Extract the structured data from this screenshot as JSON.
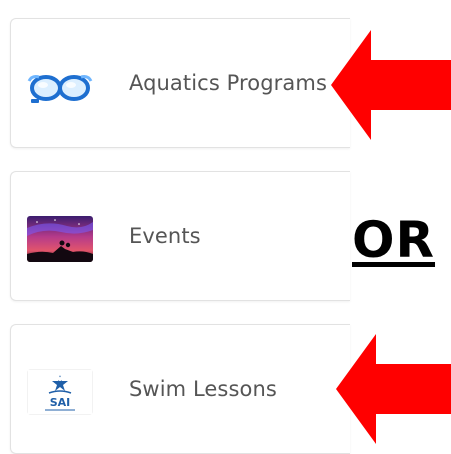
{
  "cards": [
    {
      "label": "Aquatics Programs",
      "icon": "swim-goggles-icon"
    },
    {
      "label": "Events",
      "icon": "night-sky-icon"
    },
    {
      "label": "Swim Lessons",
      "icon": "sai-logo",
      "logo_text": "SAI"
    }
  ],
  "or_text": "OR",
  "colors": {
    "arrow": "#ff0000",
    "label": "#555555",
    "card_border": "#e2e2e2"
  }
}
